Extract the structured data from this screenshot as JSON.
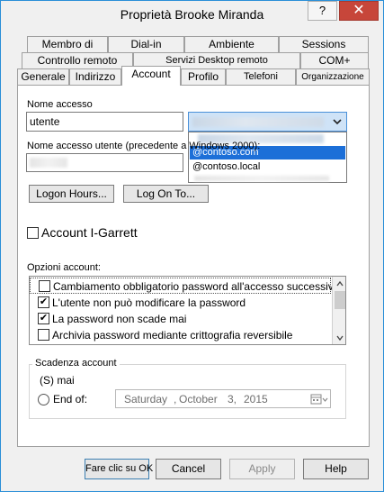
{
  "window": {
    "title": "Proprietà Brooke Miranda",
    "help_glyph": "?",
    "close_glyph": "✕"
  },
  "tabs": {
    "row1": [
      "Membro di",
      "Dial-in",
      "Ambiente",
      "Sessions"
    ],
    "row2": [
      "Controllo remoto",
      "Servizi Desktop remoto",
      "COM+"
    ],
    "row3": [
      "Generale",
      "Indirizzo",
      "Account",
      "Profilo",
      "Telefoni",
      "Organizzazione"
    ],
    "active": "Account"
  },
  "account": {
    "logon_name_label": "Nome accesso",
    "logon_name_value": "utente",
    "pre2000_label": "Nome accesso utente (precedente a Windows 2000):",
    "domain_options": [
      "@contoso.com",
      "@contoso.local"
    ],
    "logon_hours_button": "Logon Hours...",
    "log_on_to_button": "Log On To...",
    "unlock_label": "Account I-Garrett",
    "options_label": "Opzioni account:",
    "options": [
      {
        "label": "Cambiamento obbligatorio password all'accesso successivo",
        "checked": false
      },
      {
        "label": "L'utente non può modificare la password",
        "checked": true
      },
      {
        "label": "La password non scade mai",
        "checked": true
      },
      {
        "label": "Archivia password mediante crittografia reversibile",
        "checked": false
      }
    ],
    "expiry_group_label": "Scadenza account",
    "never_label": "(S) mai",
    "end_of_label": "End of:",
    "date": {
      "weekday": "Saturday",
      "month": "October",
      "day": "3,",
      "year": "2015"
    }
  },
  "footer": {
    "ok": "Fare clic su OK",
    "cancel": "Cancel",
    "apply": "Apply",
    "help": "Help"
  },
  "icons": {
    "dropdown": "chevron-down-icon",
    "scroll_up": "chevron-up-icon",
    "scroll_down": "chevron-down-icon",
    "calendar": "calendar-icon"
  }
}
